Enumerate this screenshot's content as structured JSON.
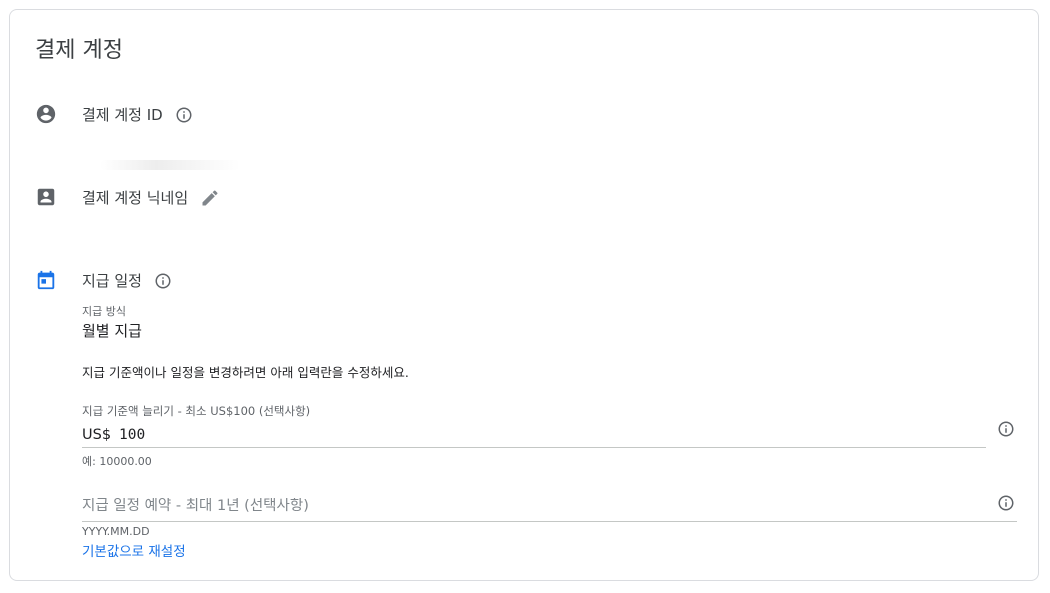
{
  "card": {
    "title": "결제 계정"
  },
  "billing_id": {
    "label": "결제 계정 ID"
  },
  "nickname": {
    "label": "결제 계정 닉네임"
  },
  "payment_schedule": {
    "label": "지급 일정",
    "method_label": "지급 방식",
    "method_value": "월별 지급",
    "description": "지급 기준액이나 일정을 변경하려면 아래 입력란을 수정하세요.",
    "threshold": {
      "label": "지급 기준액 늘리기 - 최소 US$100 (선택사항)",
      "currency": "US$",
      "value": "100",
      "hint": "예: 10000.00"
    },
    "schedule": {
      "placeholder": "지급 일정 예약 - 최대 1년 (선택사항)",
      "hint": "YYYY.MM.DD"
    },
    "reset_label": "기본값으로 재설정"
  },
  "colors": {
    "accent": "#1a73e8",
    "icon_gray": "#5f6368",
    "calendar_blue": "#1a73e8"
  },
  "icons": [
    "account-circle-icon",
    "info-icon",
    "contact-card-icon",
    "pencil-icon",
    "calendar-icon"
  ]
}
